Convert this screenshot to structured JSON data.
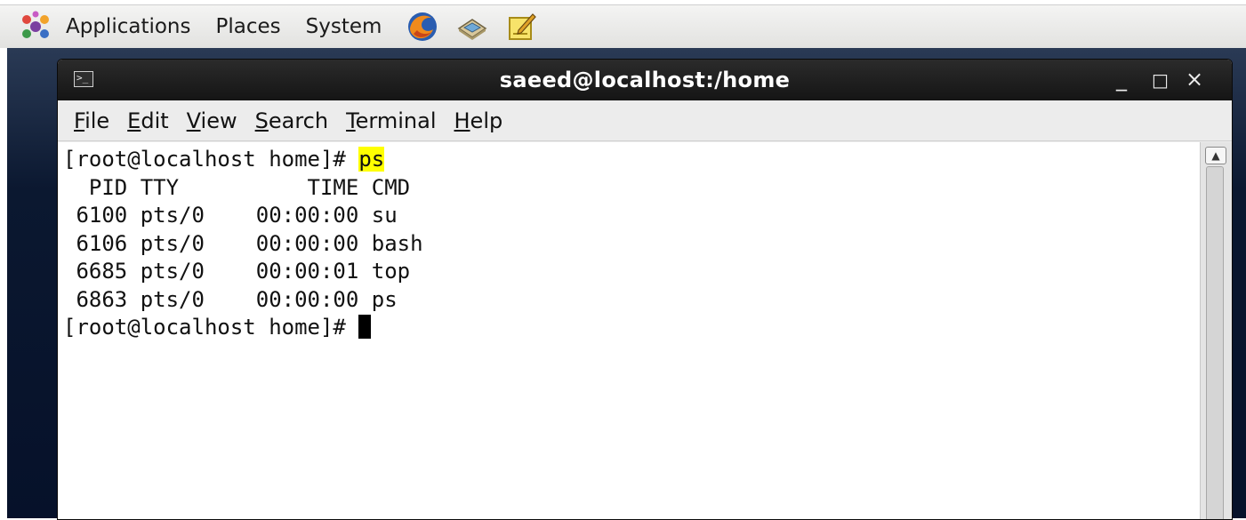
{
  "panel": {
    "logo_icon": "gnome-foot-icon",
    "menus": [
      "Applications",
      "Places",
      "System"
    ],
    "launchers": [
      "firefox-icon",
      "network-mail-icon",
      "text-editor-icon"
    ]
  },
  "window": {
    "title": "saeed@localhost:/home",
    "icon": "terminal-icon",
    "icon_glyph": ">_",
    "controls": {
      "minimize": "_",
      "maximize": "□",
      "close": "×"
    }
  },
  "menubar": [
    {
      "mnemonic": "F",
      "rest": "ile"
    },
    {
      "mnemonic": "E",
      "rest": "dit"
    },
    {
      "mnemonic": "V",
      "rest": "iew"
    },
    {
      "mnemonic": "S",
      "rest": "earch"
    },
    {
      "mnemonic": "T",
      "rest": "erminal"
    },
    {
      "mnemonic": "H",
      "rest": "elp"
    }
  ],
  "terminal": {
    "prompt": "[root@localhost home]# ",
    "command": "ps",
    "header": "  PID TTY          TIME CMD",
    "rows": [
      " 6100 pts/0    00:00:00 su",
      " 6106 pts/0    00:00:00 bash",
      " 6685 pts/0    00:00:01 top",
      " 6863 pts/0    00:00:00 ps"
    ],
    "prompt2": "[root@localhost home]# "
  },
  "colors": {
    "highlight": "#ffff00",
    "titlebar": "#1c1c1c",
    "desktop": "#0b1830"
  }
}
